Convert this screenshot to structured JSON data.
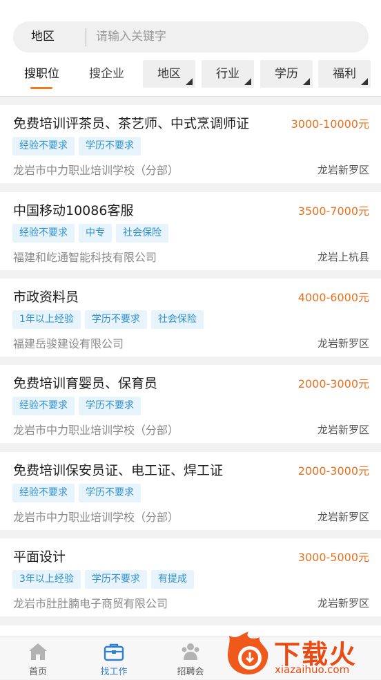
{
  "search": {
    "region_label": "地区",
    "placeholder": "请输入关键字"
  },
  "tabs": [
    {
      "label": "搜职位"
    },
    {
      "label": "搜企业"
    }
  ],
  "filters": [
    {
      "label": "地区"
    },
    {
      "label": "行业"
    },
    {
      "label": "学历"
    },
    {
      "label": "福利"
    }
  ],
  "jobs": [
    {
      "title": "免费培训评茶员、茶艺师、中式烹调师证",
      "salary": "3000-10000元",
      "tags": [
        "经验不要求",
        "学历不要求"
      ],
      "company": "龙岩市中力职业培训学校（分部）",
      "location": "龙岩新罗区"
    },
    {
      "title": "中国移动10086客服",
      "salary": "3500-7000元",
      "tags": [
        "经验不要求",
        "中专",
        "社会保险"
      ],
      "company": "福建和屹通智能科技有限公司",
      "location": "龙岩上杭县"
    },
    {
      "title": "市政资料员",
      "salary": "4000-6000元",
      "tags": [
        "1年以上经验",
        "学历不要求",
        "社会保险"
      ],
      "company": "福建岳骏建设有限公司",
      "location": "龙岩新罗区"
    },
    {
      "title": "免费培训育婴员、保育员",
      "salary": "2000-3000元",
      "tags": [
        "经验不要求",
        "学历不要求"
      ],
      "company": "龙岩市中力职业培训学校（分部）",
      "location": "龙岩新罗区"
    },
    {
      "title": "免费培训保安员证、电工证、焊工证",
      "salary": "2000-3000元",
      "tags": [
        "经验不要求",
        "学历不要求"
      ],
      "company": "龙岩市中力职业培训学校（分部）",
      "location": "龙岩新罗区"
    },
    {
      "title": "平面设计",
      "salary": "3000-5000元",
      "tags": [
        "3年以上经验",
        "学历不要求",
        "有提成"
      ],
      "company": "龙岩市肚肚腩电子商贸有限公司",
      "location": "龙岩新罗区"
    }
  ],
  "bottom_nav": [
    {
      "label": "首页",
      "icon": "home-icon"
    },
    {
      "label": "找工作",
      "icon": "briefcase-icon",
      "active": true
    },
    {
      "label": "招聘会",
      "icon": "job-fair-icon"
    }
  ],
  "watermark": {
    "text": "下载火",
    "url": "xiazaihuo.com"
  },
  "colors": {
    "accent": "#f07a1c",
    "salary": "#e8711f",
    "tag_text": "#2f8fcf",
    "tag_bg": "#e8f4fc",
    "nav_active": "#2f7fd0"
  }
}
